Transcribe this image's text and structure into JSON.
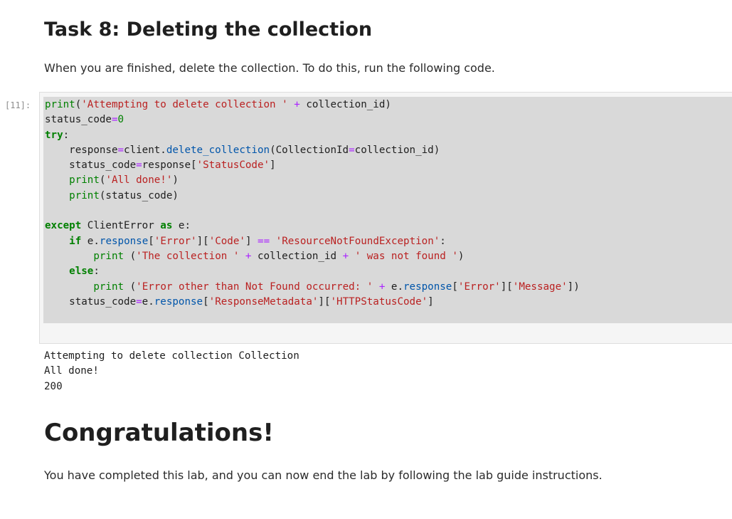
{
  "task_heading": "Task 8: Deleting the collection",
  "intro_text": "When you are finished, delete the collection. To do this, run the following code.",
  "cell": {
    "prompt": "[11]:",
    "code_lines": [
      [
        {
          "t": "print",
          "c": "bi"
        },
        {
          "t": "("
        },
        {
          "t": "'Attempting to delete collection '",
          "c": "str"
        },
        {
          "t": " "
        },
        {
          "t": "+",
          "c": "op"
        },
        {
          "t": " collection_id)"
        }
      ],
      [
        {
          "t": "status_code"
        },
        {
          "t": "=",
          "c": "op"
        },
        {
          "t": "0",
          "c": "num"
        }
      ],
      [
        {
          "t": "try",
          "c": "kw"
        },
        {
          "t": ":"
        }
      ],
      [
        {
          "t": "    response"
        },
        {
          "t": "=",
          "c": "op"
        },
        {
          "t": "client"
        },
        {
          "t": "."
        },
        {
          "t": "delete_collection",
          "c": "attr"
        },
        {
          "t": "(CollectionId"
        },
        {
          "t": "=",
          "c": "op"
        },
        {
          "t": "collection_id)"
        }
      ],
      [
        {
          "t": "    status_code"
        },
        {
          "t": "=",
          "c": "op"
        },
        {
          "t": "response["
        },
        {
          "t": "'StatusCode'",
          "c": "str"
        },
        {
          "t": "]"
        }
      ],
      [
        {
          "t": "    "
        },
        {
          "t": "print",
          "c": "bi"
        },
        {
          "t": "("
        },
        {
          "t": "'All done!'",
          "c": "str"
        },
        {
          "t": ")"
        }
      ],
      [
        {
          "t": "    "
        },
        {
          "t": "print",
          "c": "bi"
        },
        {
          "t": "(status_code)"
        }
      ],
      [
        {
          "t": ""
        }
      ],
      [
        {
          "t": "except",
          "c": "kw"
        },
        {
          "t": " ClientError "
        },
        {
          "t": "as",
          "c": "kw"
        },
        {
          "t": " e:"
        }
      ],
      [
        {
          "t": "    "
        },
        {
          "t": "if",
          "c": "kw"
        },
        {
          "t": " e"
        },
        {
          "t": "."
        },
        {
          "t": "response",
          "c": "attr"
        },
        {
          "t": "["
        },
        {
          "t": "'Error'",
          "c": "str"
        },
        {
          "t": "]["
        },
        {
          "t": "'Code'",
          "c": "str"
        },
        {
          "t": "] "
        },
        {
          "t": "==",
          "c": "op"
        },
        {
          "t": " "
        },
        {
          "t": "'ResourceNotFoundException'",
          "c": "str"
        },
        {
          "t": ":"
        }
      ],
      [
        {
          "t": "        "
        },
        {
          "t": "print",
          "c": "bi"
        },
        {
          "t": " ("
        },
        {
          "t": "'The collection '",
          "c": "str"
        },
        {
          "t": " "
        },
        {
          "t": "+",
          "c": "op"
        },
        {
          "t": " collection_id "
        },
        {
          "t": "+",
          "c": "op"
        },
        {
          "t": " "
        },
        {
          "t": "' was not found '",
          "c": "str"
        },
        {
          "t": ")"
        }
      ],
      [
        {
          "t": "    "
        },
        {
          "t": "else",
          "c": "kw"
        },
        {
          "t": ":"
        }
      ],
      [
        {
          "t": "        "
        },
        {
          "t": "print",
          "c": "bi"
        },
        {
          "t": " ("
        },
        {
          "t": "'Error other than Not Found occurred: '",
          "c": "str"
        },
        {
          "t": " "
        },
        {
          "t": "+",
          "c": "op"
        },
        {
          "t": " e"
        },
        {
          "t": "."
        },
        {
          "t": "response",
          "c": "attr"
        },
        {
          "t": "["
        },
        {
          "t": "'Error'",
          "c": "str"
        },
        {
          "t": "]["
        },
        {
          "t": "'Message'",
          "c": "str"
        },
        {
          "t": "])"
        }
      ],
      [
        {
          "t": "    status_code"
        },
        {
          "t": "=",
          "c": "op"
        },
        {
          "t": "e"
        },
        {
          "t": "."
        },
        {
          "t": "response",
          "c": "attr"
        },
        {
          "t": "["
        },
        {
          "t": "'ResponseMetadata'",
          "c": "str"
        },
        {
          "t": "]["
        },
        {
          "t": "'HTTPStatusCode'",
          "c": "str"
        },
        {
          "t": "]"
        }
      ]
    ],
    "output_lines": [
      "Attempting to delete collection Collection",
      "All done!",
      "200"
    ]
  },
  "congrats_heading": "Congratulations!",
  "final_text": "You have completed this lab, and you can now end the lab by following the lab guide instructions."
}
